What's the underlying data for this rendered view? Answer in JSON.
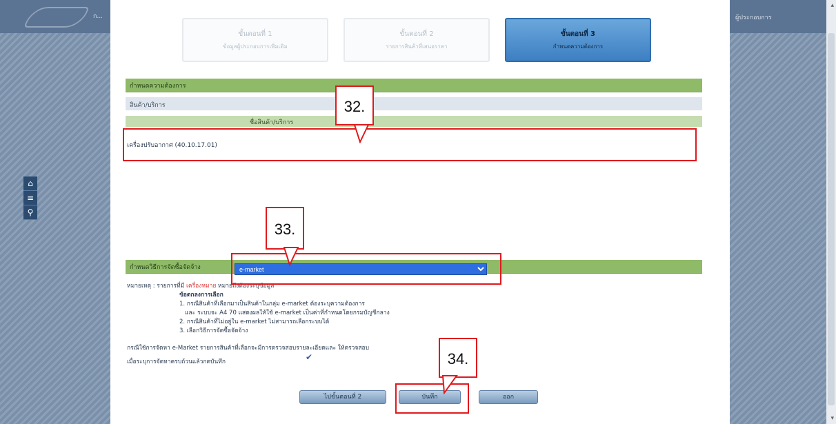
{
  "window": {
    "left_header_text": "ก...",
    "right_header_text": "ผู้ประกอบการ",
    "scroll_up": "▴",
    "scroll_down": "▾"
  },
  "side_toolbar": [
    {
      "icon": "home-icon",
      "glyph": "⌂"
    },
    {
      "icon": "list-icon",
      "glyph": "≡"
    },
    {
      "icon": "search-icon",
      "glyph": "⚲"
    }
  ],
  "steps": [
    {
      "title": "ขั้นตอนที่ 1",
      "subtitle": "ข้อมูลผู้ประกอบการเพิ่มเติม",
      "active": false
    },
    {
      "title": "ขั้นตอนที่ 2",
      "subtitle": "รายการสินค้าที่เสนอราคา",
      "active": false
    },
    {
      "title": "ขั้นตอนที่ 3",
      "subtitle": "กำหนดความต้องการ",
      "active": true
    }
  ],
  "section_title": "กำหนดความต้องการ",
  "list_header": "สินค้า/บริการ",
  "column_header": "ชื่อสินค้า/บริการ",
  "item_text": "เครื่องปรับอากาศ (40.10.17.01)",
  "category_label": "กำหนดวิธีการจัดซื้อจัดจ้าง",
  "category_select": {
    "selected": "e-market",
    "options": [
      "e-market"
    ]
  },
  "notes": {
    "remark_prefix": "หมายเหตุ : รายการที่มี",
    "remark_red": "เครื่องหมาย",
    "remark_suffix": "หมายถึงต้องระบุข้อมูล",
    "heading": "ข้อตกลงการเลือก",
    "line1": "1. กรณีสินค้าที่เลือกมาเป็นสินค้าในกลุ่ม e-market ต้องระบุความต้องการ",
    "line1b": "และ ระบบจะ A4 70 แสดงผลให้ใช้ e-market เป็นค่าที่กำหนดโดยกรมบัญชีกลาง",
    "line2": "2. กรณีสินค้าที่ไม่อยู่ใน e-market ไม่สามารถเลือกระบบได้",
    "line3": "3. เลือกวิธีการจัดซื้อจัดจ้าง",
    "line4": "กรณีใช้การจัดหา e-Market รายการสินค้าที่เลือกจะมีการตรวจสอบรายละเอียดและ ให้ตรวจสอบ",
    "line5": "เมื่อระบุการจัดหาครบถ้วนแล้วกดบันทึก"
  },
  "buttons": {
    "back": "ไปขั้นตอนที่ 2",
    "save": "บันทึก",
    "exit": "ออก"
  },
  "callouts": [
    "32.",
    "33.",
    "34."
  ],
  "colors": {
    "highlight_red": "#e0191d",
    "section_green": "#8fba67",
    "select_blue": "#2e6ee0"
  }
}
